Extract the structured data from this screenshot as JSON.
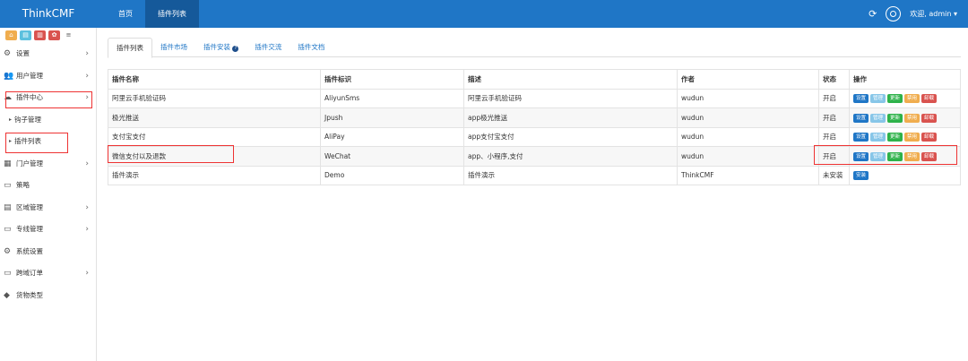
{
  "app": {
    "title": "ThinkCMF"
  },
  "topnav": [
    {
      "label": "首页"
    },
    {
      "label": "插件列表"
    }
  ],
  "user": {
    "greeting": "欢迎, admin ▾"
  },
  "sidebar": {
    "items": [
      {
        "label": "设置",
        "icon": "gear-icon"
      },
      {
        "label": "用户管理",
        "icon": "users-icon"
      },
      {
        "label": "插件中心",
        "icon": "cloud-icon"
      },
      {
        "label": "钩子管理",
        "icon": "caret-right-icon"
      },
      {
        "label": "插件列表",
        "icon": "caret-right-icon"
      },
      {
        "label": "门户管理",
        "icon": "grid-icon"
      },
      {
        "label": "策略",
        "icon": "monitor-icon"
      },
      {
        "label": "区域管理",
        "icon": "table-icon"
      },
      {
        "label": "专线管理",
        "icon": "monitor-icon"
      },
      {
        "label": "系统设置",
        "icon": "gear-icon"
      },
      {
        "label": "跨域订单",
        "icon": "monitor-icon"
      },
      {
        "label": "货物类型",
        "icon": "tag-icon"
      }
    ]
  },
  "tabs": [
    {
      "label": "插件列表"
    },
    {
      "label": "插件市场"
    },
    {
      "label": "插件安装"
    },
    {
      "label": "插件交流"
    },
    {
      "label": "插件文档"
    }
  ],
  "table": {
    "headers": [
      "插件名称",
      "插件标识",
      "描述",
      "作者",
      "状态",
      "操作"
    ],
    "rows": [
      {
        "name": "阿里云手机验证码",
        "id": "AliyunSms",
        "desc": "阿里云手机验证码",
        "author": "wudun",
        "status": "开启",
        "installed": true
      },
      {
        "name": "极光推送",
        "id": "Jpush",
        "desc": "app极光推送",
        "author": "wudun",
        "status": "开启",
        "installed": true
      },
      {
        "name": "支付宝支付",
        "id": "AliPay",
        "desc": "app支付宝支付",
        "author": "wudun",
        "status": "开启",
        "installed": true
      },
      {
        "name": "微信支付以及退款",
        "id": "WeChat",
        "desc": "app、小程序,支付",
        "author": "wudun",
        "status": "开启",
        "installed": true
      },
      {
        "name": "插件演示",
        "id": "Demo",
        "desc": "插件演示",
        "author": "ThinkCMF",
        "status": "未安装",
        "installed": false
      }
    ],
    "actions": [
      "设置",
      "管理",
      "更新",
      "禁用",
      "卸载"
    ],
    "install_label": "安装"
  },
  "colors": {
    "header": "#1f76c6",
    "highlight": "#e33333"
  }
}
